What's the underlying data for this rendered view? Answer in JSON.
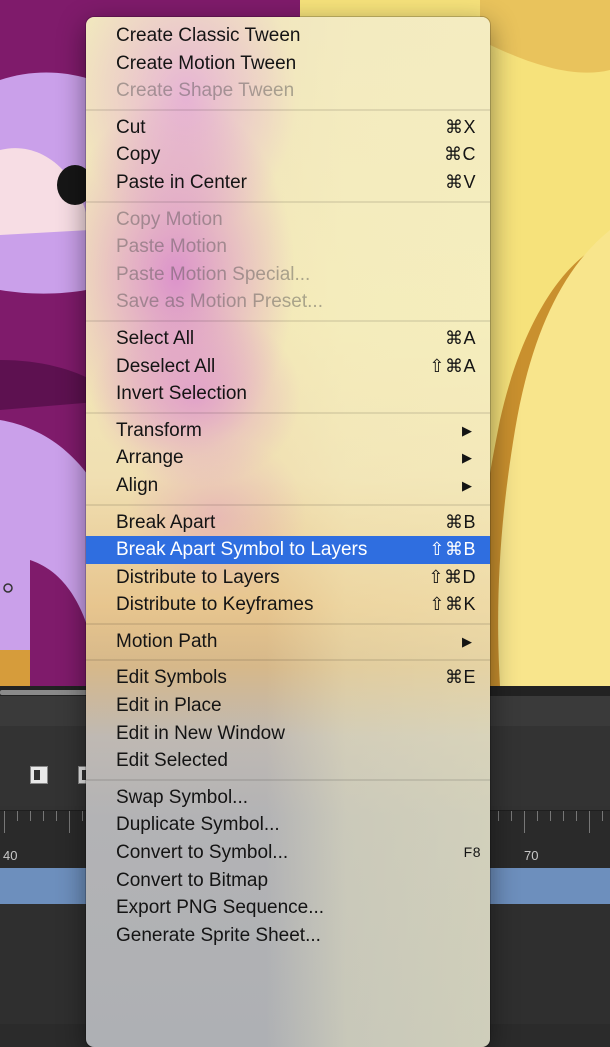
{
  "colors": {
    "accent": "#2f6ee0",
    "stage_purple": "#7f1b6b",
    "stage_lilac": "#caa0ea",
    "stage_yellow": "#f6e27b",
    "stage_orange": "#c9902e",
    "timeline_layer": "#6d8fbd"
  },
  "timeline": {
    "label_left": "40",
    "label_right": "70"
  },
  "menu": {
    "items": [
      {
        "type": "item",
        "label": "Create Classic Tween",
        "shortcut": "",
        "disabled": false,
        "submenu": false,
        "name": "create-classic-tween"
      },
      {
        "type": "item",
        "label": "Create Motion Tween",
        "shortcut": "",
        "disabled": false,
        "submenu": false,
        "name": "create-motion-tween"
      },
      {
        "type": "item",
        "label": "Create Shape Tween",
        "shortcut": "",
        "disabled": true,
        "submenu": false,
        "name": "create-shape-tween"
      },
      {
        "type": "separator"
      },
      {
        "type": "item",
        "label": "Cut",
        "shortcut": "⌘X",
        "disabled": false,
        "submenu": false,
        "name": "cut"
      },
      {
        "type": "item",
        "label": "Copy",
        "shortcut": "⌘C",
        "disabled": false,
        "submenu": false,
        "name": "copy"
      },
      {
        "type": "item",
        "label": "Paste in Center",
        "shortcut": "⌘V",
        "disabled": false,
        "submenu": false,
        "name": "paste-in-center"
      },
      {
        "type": "separator"
      },
      {
        "type": "item",
        "label": "Copy Motion",
        "shortcut": "",
        "disabled": true,
        "submenu": false,
        "name": "copy-motion"
      },
      {
        "type": "item",
        "label": "Paste Motion",
        "shortcut": "",
        "disabled": true,
        "submenu": false,
        "name": "paste-motion"
      },
      {
        "type": "item",
        "label": "Paste Motion Special...",
        "shortcut": "",
        "disabled": true,
        "submenu": false,
        "name": "paste-motion-special"
      },
      {
        "type": "item",
        "label": "Save as Motion Preset...",
        "shortcut": "",
        "disabled": true,
        "submenu": false,
        "name": "save-as-motion-preset"
      },
      {
        "type": "separator"
      },
      {
        "type": "item",
        "label": "Select All",
        "shortcut": "⌘A",
        "disabled": false,
        "submenu": false,
        "name": "select-all"
      },
      {
        "type": "item",
        "label": "Deselect All",
        "shortcut": "⇧⌘A",
        "disabled": false,
        "submenu": false,
        "name": "deselect-all"
      },
      {
        "type": "item",
        "label": "Invert Selection",
        "shortcut": "",
        "disabled": false,
        "submenu": false,
        "name": "invert-selection"
      },
      {
        "type": "separator"
      },
      {
        "type": "item",
        "label": "Transform",
        "shortcut": "",
        "disabled": false,
        "submenu": true,
        "name": "transform"
      },
      {
        "type": "item",
        "label": "Arrange",
        "shortcut": "",
        "disabled": false,
        "submenu": true,
        "name": "arrange"
      },
      {
        "type": "item",
        "label": "Align",
        "shortcut": "",
        "disabled": false,
        "submenu": true,
        "name": "align"
      },
      {
        "type": "separator"
      },
      {
        "type": "item",
        "label": "Break Apart",
        "shortcut": "⌘B",
        "disabled": false,
        "submenu": false,
        "name": "break-apart"
      },
      {
        "type": "item",
        "label": "Break Apart Symbol to Layers",
        "shortcut": "⇧⌘B",
        "disabled": false,
        "submenu": false,
        "active": true,
        "name": "break-apart-symbol-to-layers"
      },
      {
        "type": "item",
        "label": "Distribute to Layers",
        "shortcut": "⇧⌘D",
        "disabled": false,
        "submenu": false,
        "name": "distribute-to-layers"
      },
      {
        "type": "item",
        "label": "Distribute to Keyframes",
        "shortcut": "⇧⌘K",
        "disabled": false,
        "submenu": false,
        "name": "distribute-to-keyframes"
      },
      {
        "type": "separator"
      },
      {
        "type": "item",
        "label": "Motion Path",
        "shortcut": "",
        "disabled": false,
        "submenu": true,
        "name": "motion-path"
      },
      {
        "type": "separator"
      },
      {
        "type": "item",
        "label": "Edit Symbols",
        "shortcut": "⌘E",
        "disabled": false,
        "submenu": false,
        "name": "edit-symbols"
      },
      {
        "type": "item",
        "label": "Edit in Place",
        "shortcut": "",
        "disabled": false,
        "submenu": false,
        "name": "edit-in-place"
      },
      {
        "type": "item",
        "label": "Edit in New Window",
        "shortcut": "",
        "disabled": false,
        "submenu": false,
        "name": "edit-in-new-window"
      },
      {
        "type": "item",
        "label": "Edit Selected",
        "shortcut": "",
        "disabled": false,
        "submenu": false,
        "name": "edit-selected"
      },
      {
        "type": "separator"
      },
      {
        "type": "item",
        "label": "Swap Symbol...",
        "shortcut": "",
        "disabled": false,
        "submenu": false,
        "name": "swap-symbol"
      },
      {
        "type": "item",
        "label": "Duplicate Symbol...",
        "shortcut": "",
        "disabled": false,
        "submenu": false,
        "name": "duplicate-symbol"
      },
      {
        "type": "item",
        "label": "Convert to Symbol...",
        "shortcut": "F8",
        "disabled": false,
        "submenu": false,
        "name": "convert-to-symbol"
      },
      {
        "type": "item",
        "label": "Convert to Bitmap",
        "shortcut": "",
        "disabled": false,
        "submenu": false,
        "name": "convert-to-bitmap"
      },
      {
        "type": "item",
        "label": "Export PNG Sequence...",
        "shortcut": "",
        "disabled": false,
        "submenu": false,
        "name": "export-png-sequence"
      },
      {
        "type": "item",
        "label": "Generate Sprite Sheet...",
        "shortcut": "",
        "disabled": false,
        "submenu": false,
        "name": "generate-sprite-sheet"
      }
    ],
    "submenu_arrow": "▶"
  }
}
